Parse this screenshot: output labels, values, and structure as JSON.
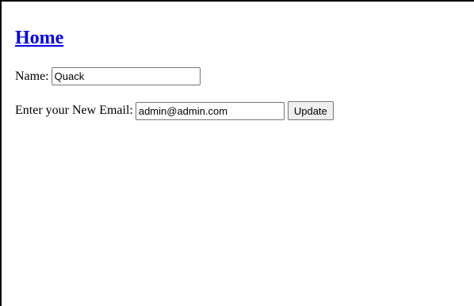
{
  "header": {
    "home_link": "Home"
  },
  "form": {
    "name_label": "Name:",
    "name_value": "Quack",
    "email_label": "Enter your New Email:",
    "email_value": "admin@admin.com",
    "update_label": "Update"
  },
  "colors": {
    "link": "#0000ee",
    "border": "#000000",
    "button_bg": "#efefef"
  }
}
